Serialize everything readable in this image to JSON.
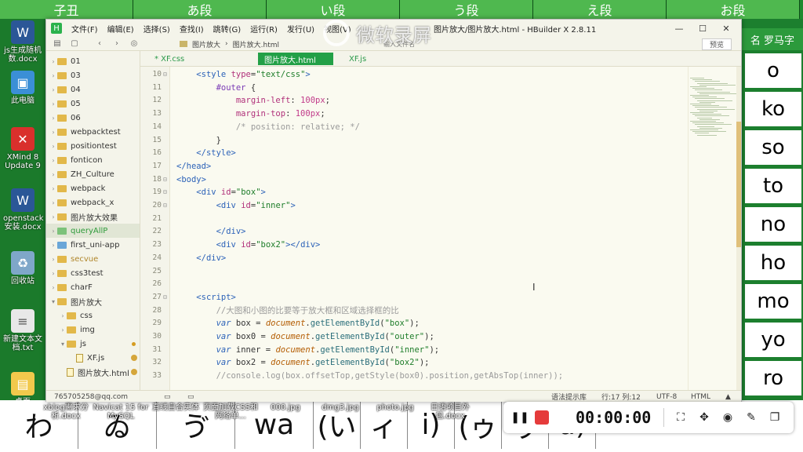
{
  "window": {
    "app_logo": "H",
    "menu": [
      "文件(F)",
      "编辑(E)",
      "选择(S)",
      "查找(I)",
      "跳转(G)",
      "运行(R)",
      "发行(U)",
      "视图(V)"
    ],
    "title": "图片放大/图片放大.html - HBuilder X 2.8.11",
    "minimize": "—",
    "maximize": "☐",
    "close": "✕"
  },
  "toolbar": {
    "breadcrumb": [
      "图片放大",
      "图片放大.html"
    ],
    "search_placeholder": "输入文件名",
    "preview_label": "预览"
  },
  "watermark": "微软录屏",
  "sidebar": {
    "items": [
      {
        "label": "01",
        "kind": "folder",
        "indent": 0
      },
      {
        "label": "03",
        "kind": "folder",
        "indent": 0
      },
      {
        "label": "04",
        "kind": "folder",
        "indent": 0
      },
      {
        "label": "05",
        "kind": "folder",
        "indent": 0
      },
      {
        "label": "06",
        "kind": "folder",
        "indent": 0
      },
      {
        "label": "webpacktest",
        "kind": "folder",
        "indent": 0
      },
      {
        "label": "positiontest",
        "kind": "folder",
        "indent": 0
      },
      {
        "label": "fonticon",
        "kind": "folder",
        "indent": 0
      },
      {
        "label": "ZH_Culture",
        "kind": "folder",
        "indent": 0
      },
      {
        "label": "webpack",
        "kind": "folder",
        "indent": 0
      },
      {
        "label": "webpack_x",
        "kind": "folder",
        "indent": 0
      },
      {
        "label": "图片放大效果",
        "kind": "folder",
        "indent": 0
      },
      {
        "label": "queryAllP",
        "kind": "folder",
        "indent": 0,
        "style": "green",
        "selected": true
      },
      {
        "label": "first_uni-app",
        "kind": "project",
        "indent": 0
      },
      {
        "label": "secvue",
        "kind": "folder",
        "indent": 0,
        "style": "gold"
      },
      {
        "label": "css3test",
        "kind": "folder",
        "indent": 0
      },
      {
        "label": "charF",
        "kind": "folder",
        "indent": 0
      },
      {
        "label": "图片放大",
        "kind": "folder",
        "indent": 0,
        "expanded": true
      },
      {
        "label": "css",
        "kind": "folder",
        "indent": 1
      },
      {
        "label": "img",
        "kind": "folder",
        "indent": 1
      },
      {
        "label": "js",
        "kind": "folder",
        "indent": 1,
        "expanded": true,
        "modified": true
      },
      {
        "label": "XF.js",
        "kind": "file",
        "indent": 2,
        "badge": true
      },
      {
        "label": "图片放大.html",
        "kind": "file",
        "indent": 1,
        "badge": true
      }
    ],
    "account": "765705258@qq.com"
  },
  "tabs": [
    {
      "label": "* XF.css",
      "active": false
    },
    {
      "label": "图片放大.html",
      "active": true
    },
    {
      "label": "XF.js",
      "active": false
    }
  ],
  "code": [
    {
      "n": "10",
      "fold": "⊟",
      "html": "    <span class='t'>&lt;style</span> <span class='a'>type</span>=<span class='s'>\"text/css\"</span><span class='t'>&gt;</span>"
    },
    {
      "n": "11",
      "fold": "",
      "html": "        <span class='sel'>#outer</span> {"
    },
    {
      "n": "12",
      "fold": "",
      "html": "            <span class='a'>margin-left</span>: <span class='n'>100px</span>;"
    },
    {
      "n": "13",
      "fold": "",
      "html": "            <span class='a'>margin-top</span>: <span class='n'>100px</span>;"
    },
    {
      "n": "14",
      "fold": "",
      "html": "            <span class='c'>/* position: relative; */</span>"
    },
    {
      "n": "15",
      "fold": "",
      "html": "        }"
    },
    {
      "n": "16",
      "fold": "",
      "html": "    <span class='t'>&lt;/style&gt;</span>"
    },
    {
      "n": "17",
      "fold": "",
      "html": "<span class='t'>&lt;/head&gt;</span>"
    },
    {
      "n": "18",
      "fold": "⊟",
      "html": "<span class='t'>&lt;body&gt;</span>"
    },
    {
      "n": "19",
      "fold": "⊟",
      "html": "    <span class='t'>&lt;div</span> <span class='a'>id</span>=<span class='s'>\"box\"</span><span class='t'>&gt;</span>"
    },
    {
      "n": "20",
      "fold": "⊟",
      "html": "        <span class='t'>&lt;div</span> <span class='a'>id</span>=<span class='s'>\"inner\"</span><span class='t'>&gt;</span>"
    },
    {
      "n": "21",
      "fold": "",
      "html": ""
    },
    {
      "n": "22",
      "fold": "",
      "html": "        <span class='t'>&lt;/div&gt;</span>"
    },
    {
      "n": "23",
      "fold": "",
      "html": "        <span class='t'>&lt;div</span> <span class='a'>id</span>=<span class='s'>\"box2\"</span><span class='t'>&gt;&lt;/div&gt;</span>"
    },
    {
      "n": "24",
      "fold": "",
      "html": "    <span class='t'>&lt;/div&gt;</span>"
    },
    {
      "n": "25",
      "fold": "",
      "html": ""
    },
    {
      "n": "26",
      "fold": "",
      "html": ""
    },
    {
      "n": "27",
      "fold": "⊟",
      "html": "    <span class='t'>&lt;script&gt;</span>"
    },
    {
      "n": "28",
      "fold": "",
      "html": "        <span class='c'>//大图和小图的比要等于放大框和区域选择框的比</span>"
    },
    {
      "n": "29",
      "fold": "",
      "html": "        <span class='k'>var</span> box = <span class='doc'>document</span>.<span class='fn'>getElementById</span>(<span class='s'>\"box\"</span>);"
    },
    {
      "n": "30",
      "fold": "",
      "html": "        <span class='k'>var</span> box0 = <span class='doc'>document</span>.<span class='fn'>getElementById</span>(<span class='s'>\"outer\"</span>);"
    },
    {
      "n": "31",
      "fold": "",
      "html": "        <span class='k'>var</span> inner = <span class='doc'>document</span>.<span class='fn'>getElementById</span>(<span class='s'>\"inner\"</span>);"
    },
    {
      "n": "32",
      "fold": "",
      "html": "        <span class='k'>var</span> box2 = <span class='doc'>document</span>.<span class='fn'>getElementById</span>(<span class='s'>\"box2\"</span>);"
    },
    {
      "n": "33",
      "fold": "",
      "html": "        <span class='c'>//console.log(box.offsetTop,getStyle(box0).position,getAbsTop(inner));</span>"
    }
  ],
  "status": {
    "hint": "语法提示库",
    "position": "行:17  列:12",
    "encoding": "UTF-8",
    "language": "HTML"
  },
  "desktop": {
    "icons": [
      {
        "label": "js生成随机数.docx",
        "color": "#2b5797",
        "glyph": "W"
      },
      {
        "label": "此电脑",
        "color": "#3b8fd6",
        "glyph": "▣"
      },
      {
        "label": "XMind 8 Update 9",
        "color": "#d9302c",
        "glyph": "✕"
      },
      {
        "label": "openstack安装.docx",
        "color": "#2b5797",
        "glyph": "W"
      },
      {
        "label": "回收站",
        "color": "#7fa7c9",
        "glyph": "♻"
      },
      {
        "label": "新建文本文档.txt",
        "color": "#e8e8e8",
        "glyph": "≡"
      },
      {
        "label": "桌面",
        "color": "#f2c94c",
        "glyph": "▤"
      }
    ],
    "bottom_labels": [
      "xblog需求分析.docx",
      "Navicat 15 for MySQL",
      "直线自合实体",
      "页面加载CSS和网络单...",
      "000.jpg",
      "dmg3.jpg",
      "photo.jpg",
      "日语项目外包.docx"
    ],
    "bottom_kana": [
      "わ",
      "ゐ",
      "ゔ",
      "wa",
      "(い",
      "ィ",
      "i)",
      "(ゥ",
      "ゥ",
      "u)"
    ],
    "top_banner": [
      "子丑",
      "あ段",
      "い段",
      "う段",
      "え段",
      "お段"
    ]
  },
  "kana": {
    "header": "名 罗马字",
    "cells": [
      "o",
      "ko",
      "so",
      "to",
      "no",
      "ho",
      "mo",
      "yo",
      "ro"
    ]
  },
  "recorder": {
    "time": "00:00:00",
    "pause": "❚❚"
  }
}
